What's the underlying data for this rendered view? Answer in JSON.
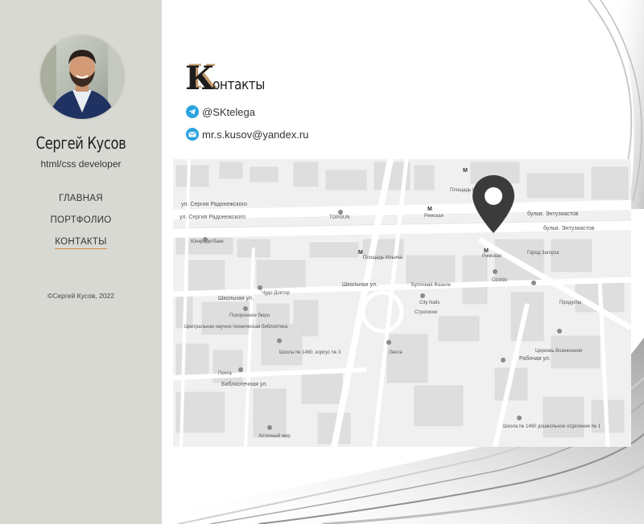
{
  "sidebar": {
    "name": "Сергей Кусов",
    "role": "html/css developer",
    "nav": [
      {
        "label": "ГЛАВНАЯ",
        "active": false
      },
      {
        "label": "ПОРТФОЛИО",
        "active": false
      },
      {
        "label": "КОНТАКТЫ",
        "active": true
      }
    ],
    "copyright": "©Сергей Кусов, 2022"
  },
  "main": {
    "title_first_letter": "К",
    "title_rest": "онтакты",
    "telegram": "@SKtelega",
    "email": "mr.s.kusov@yandex.ru"
  },
  "map": {
    "streets": {
      "s1": "ул. Сергия Радонежского",
      "s2": "ул. Сергия Радонежского",
      "s3": "бульв. Энтузиастов",
      "s4": "бульв. Энтузиастов",
      "s5": "Школьная ул.",
      "s6": "Школьная ул.",
      "s7": "Библиотечная ул.",
      "s8": "Рабочая ул."
    },
    "places": {
      "p1": "Площадь Ильича",
      "p2": "Римская",
      "p3": "Римская",
      "p4": "Площадь Ильича",
      "p5": "TOPGUN",
      "p6": "Булочная Фазиле",
      "p7": "City Nails",
      "p8": "Строгиски",
      "p9": "Город Загорск",
      "p10": "Ozoldo",
      "p11": "Школа № 1460, корпус № 3",
      "p12": "Центральная научно-техническая библиотека",
      "p13": "Церковь Вознесения",
      "p14": "Лента",
      "p15": "Почта",
      "p16": "Аптечный мир",
      "p17": "Продукты",
      "p18": "Юнкредитбанк",
      "p19": "Чудо Доктор",
      "p20": "Похоронное бюро",
      "p21": "Школа № 1460 дошкольное отделение № 1"
    }
  }
}
